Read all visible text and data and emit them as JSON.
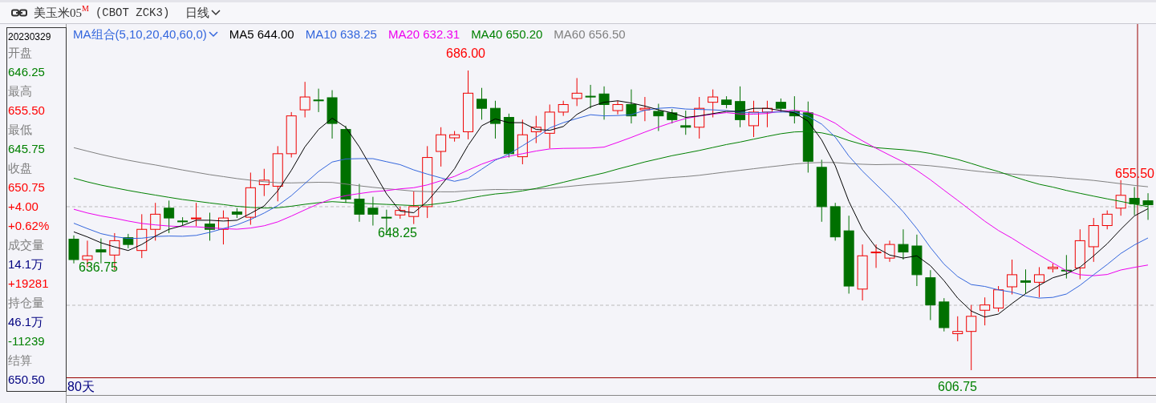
{
  "header": {
    "title": "美玉米05",
    "badge": "M",
    "code": "(CBOT ZCK3)",
    "period": "日线"
  },
  "legend": {
    "group": "MA组合(5,10,20,40,60,0)",
    "items": [
      {
        "label": "MA5 644.00",
        "color": "#000000"
      },
      {
        "label": "MA10 638.25",
        "color": "#3366dd"
      },
      {
        "label": "MA20 632.31",
        "color": "#ee00ee"
      },
      {
        "label": "MA40 650.20",
        "color": "#008000"
      },
      {
        "label": "MA60 656.50",
        "color": "#808080"
      }
    ]
  },
  "info_panel": {
    "date": "20230329",
    "rows": [
      {
        "text": "开盘",
        "color": "#808080"
      },
      {
        "text": "646.25",
        "color": "#008000"
      },
      {
        "text": "最高",
        "color": "#808080"
      },
      {
        "text": "655.50",
        "color": "#ff0000"
      },
      {
        "text": "最低",
        "color": "#808080"
      },
      {
        "text": "645.75",
        "color": "#008000"
      },
      {
        "text": "收盘",
        "color": "#808080"
      },
      {
        "text": "650.75",
        "color": "#ff0000"
      },
      {
        "text": "+4.00",
        "color": "#ff0000"
      },
      {
        "text": "+0.62%",
        "color": "#ff0000"
      },
      {
        "text": "成交量",
        "color": "#808080"
      },
      {
        "text": "14.1万",
        "color": "#000080"
      },
      {
        "text": "+19281",
        "color": "#ff0000"
      },
      {
        "text": "持仓量",
        "color": "#808080"
      },
      {
        "text": "46.1万",
        "color": "#000080"
      },
      {
        "text": "-11239",
        "color": "#008000"
      },
      {
        "text": "结算",
        "color": "#808080"
      },
      {
        "text": "650.50",
        "color": "#000080"
      }
    ]
  },
  "chart": {
    "price_labels": [
      {
        "text": "686.00",
        "color": "#ff0000"
      },
      {
        "text": "648.25",
        "color": "#008000"
      },
      {
        "text": "636.75",
        "color": "#008000"
      },
      {
        "text": "606.75",
        "color": "#008000"
      },
      {
        "text": "655.50",
        "color": "#ff0000"
      }
    ]
  },
  "footer": {
    "days": "80天"
  }
}
